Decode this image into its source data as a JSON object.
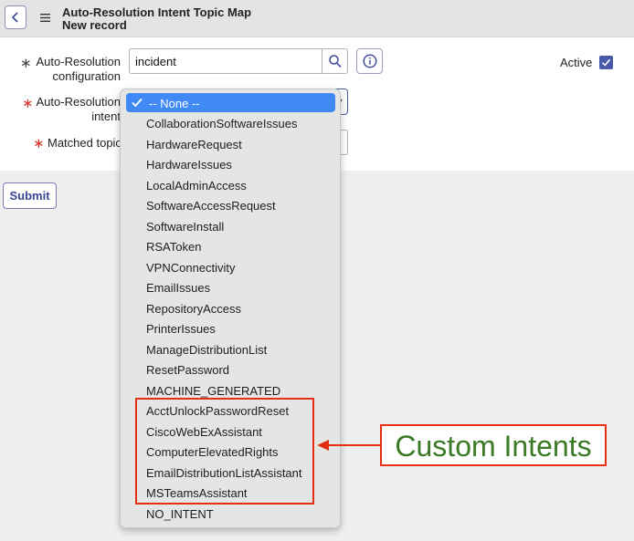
{
  "header": {
    "title": "Auto-Resolution Intent Topic Map",
    "subtitle": "New record"
  },
  "form": {
    "config_label_line1": "Auto-Resolution",
    "config_label_line2": "configuration",
    "config_value": "incident",
    "intent_label_line1": "Auto-Resolution",
    "intent_label_line2": "intent",
    "topic_label": "Matched topic",
    "active_label": "Active",
    "active_checked": true,
    "required_symbol": "∗"
  },
  "submit_label": "Submit",
  "dropdown": {
    "selected": "-- None --",
    "options": [
      "CollaborationSoftwareIssues",
      "HardwareRequest",
      "HardwareIssues",
      "LocalAdminAccess",
      "SoftwareAccessRequest",
      "SoftwareInstall",
      "RSAToken",
      "VPNConnectivity",
      "EmailIssues",
      "RepositoryAccess",
      "PrinterIssues",
      "ManageDistributionList",
      "ResetPassword",
      "MACHINE_GENERATED",
      "AcctUnlockPasswordReset",
      "CiscoWebExAssistant",
      "ComputerElevatedRights",
      "EmailDistributionListAssistant",
      "MSTeamsAssistant",
      "NO_INTENT"
    ]
  },
  "annotation": {
    "callout_text": "Custom Intents"
  },
  "colors": {
    "accent": "#4a5aa8",
    "selection": "#4189f4",
    "annotation_red": "#e62d16",
    "annotation_green": "#3b7a25",
    "required_red": "#d8332a"
  },
  "icons": [
    "chevron-left-icon",
    "menu-icon",
    "search-icon",
    "info-icon",
    "checkmark-icon",
    "chevron-down-icon",
    "arrow-left-icon"
  ]
}
